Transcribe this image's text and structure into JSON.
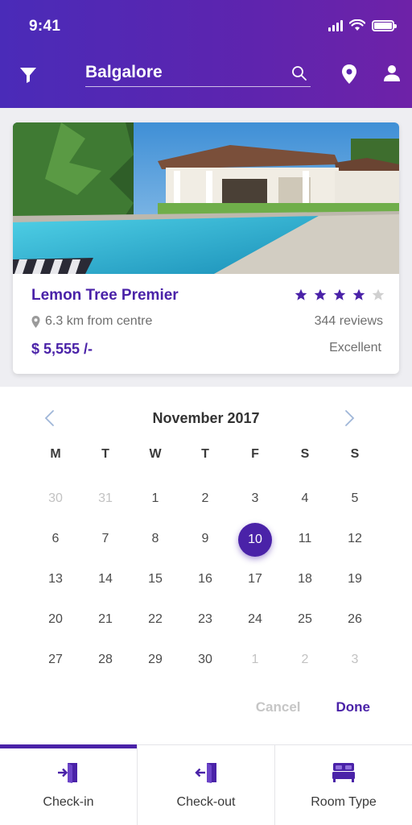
{
  "status_bar": {
    "time": "9:41"
  },
  "search": {
    "value": "Balgalore"
  },
  "hotel": {
    "name": "Lemon Tree Premier",
    "rating_stars": 4,
    "rating_max": 5,
    "distance": "6.3 km from centre",
    "reviews": "344 reviews",
    "price": "$ 5,555 /-",
    "rating_text": "Excellent"
  },
  "calendar": {
    "title": "November 2017",
    "weekdays": [
      "M",
      "T",
      "W",
      "T",
      "F",
      "S",
      "S"
    ],
    "weeks": [
      [
        {
          "d": "30",
          "muted": true
        },
        {
          "d": "31",
          "muted": true
        },
        {
          "d": "1"
        },
        {
          "d": "2"
        },
        {
          "d": "3"
        },
        {
          "d": "4"
        },
        {
          "d": "5"
        }
      ],
      [
        {
          "d": "6"
        },
        {
          "d": "7"
        },
        {
          "d": "8"
        },
        {
          "d": "9"
        },
        {
          "d": "10",
          "selected": true
        },
        {
          "d": "11"
        },
        {
          "d": "12"
        }
      ],
      [
        {
          "d": "13"
        },
        {
          "d": "14"
        },
        {
          "d": "15"
        },
        {
          "d": "16"
        },
        {
          "d": "17"
        },
        {
          "d": "18"
        },
        {
          "d": "19"
        }
      ],
      [
        {
          "d": "20"
        },
        {
          "d": "21"
        },
        {
          "d": "22"
        },
        {
          "d": "23"
        },
        {
          "d": "24"
        },
        {
          "d": "25"
        },
        {
          "d": "26"
        }
      ],
      [
        {
          "d": "27"
        },
        {
          "d": "28"
        },
        {
          "d": "29"
        },
        {
          "d": "30"
        },
        {
          "d": "1",
          "muted": true
        },
        {
          "d": "2",
          "muted": true
        },
        {
          "d": "3",
          "muted": true
        }
      ]
    ],
    "cancel_label": "Cancel",
    "done_label": "Done"
  },
  "tabs": [
    {
      "label": "Check-in",
      "icon": "check-in-icon",
      "active": true
    },
    {
      "label": "Check-out",
      "icon": "check-out-icon",
      "active": false
    },
    {
      "label": "Room Type",
      "icon": "bed-icon",
      "active": false
    }
  ],
  "colors": {
    "accent": "#4a22a8",
    "header_start": "#4a2bb8",
    "header_end": "#6e22a8",
    "star": "#4a22a8",
    "star_empty": "#d0d0d0"
  }
}
